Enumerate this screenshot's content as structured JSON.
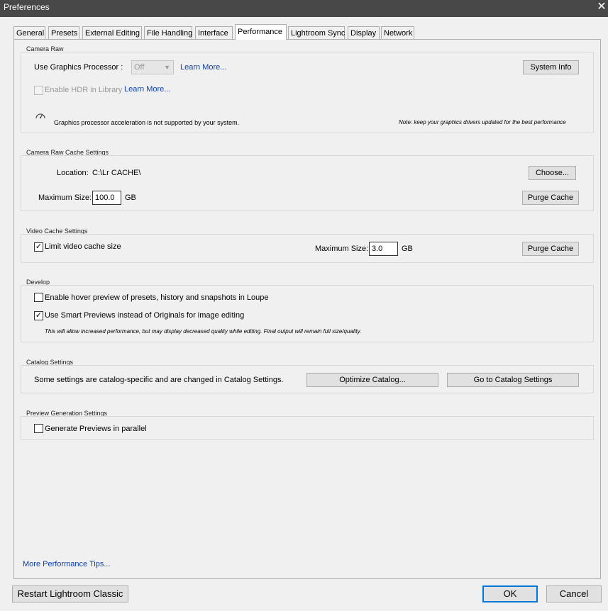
{
  "window": {
    "title": "Preferences",
    "close_glyph": "✕"
  },
  "tabs": [
    {
      "label": "General"
    },
    {
      "label": "Presets"
    },
    {
      "label": "External Editing"
    },
    {
      "label": "File Handling"
    },
    {
      "label": "Interface"
    },
    {
      "label": "Performance",
      "active": true
    },
    {
      "label": "Lightroom Sync"
    },
    {
      "label": "Display"
    },
    {
      "label": "Network"
    }
  ],
  "camera_raw": {
    "title": "Camera Raw",
    "gpu_label": "Use Graphics Processor :",
    "gpu_value": "Off",
    "learn_more": "Learn More...",
    "system_info": "System Info",
    "hdr_label": "Enable HDR in Library",
    "hdr_learn_more": "Learn More...",
    "hdr_checked": false,
    "gpu_message": "Graphics processor acceleration is not supported by your system.",
    "gpu_note": "Note: keep your graphics drivers updated for the best performance",
    "gauge_icon": "gauge-icon"
  },
  "cache": {
    "title": "Camera Raw Cache Settings",
    "location_label": "Location:",
    "location_value": "C:\\Lr CACHE\\",
    "choose": "Choose...",
    "max_size_label": "Maximum Size:",
    "max_size_value": "100.0",
    "unit": "GB",
    "purge": "Purge Cache"
  },
  "video_cache": {
    "title": "Video Cache Settings",
    "limit_label": "Limit video cache size",
    "limit_checked": true,
    "max_size_label": "Maximum Size:",
    "max_size_value": "3.0",
    "unit": "GB",
    "purge": "Purge Cache"
  },
  "develop": {
    "title": "Develop",
    "hover_label": "Enable hover preview of presets, history and snapshots in Loupe",
    "hover_checked": false,
    "smart_label": "Use Smart Previews instead of Originals for image editing",
    "smart_checked": true,
    "smart_note": "This will allow increased performance, but may display decreased quality while editing. Final output will remain full size/quality."
  },
  "catalog": {
    "title": "Catalog Settings",
    "text": "Some settings are catalog-specific and are changed in Catalog Settings.",
    "optimize": "Optimize Catalog...",
    "goto": "Go to Catalog Settings"
  },
  "preview": {
    "title": "Preview Generation Settings",
    "parallel_label": "Generate Previews in parallel",
    "parallel_checked": false
  },
  "tips_link": "More Performance Tips...",
  "footer": {
    "restart": "Restart Lightroom Classic",
    "ok": "OK",
    "cancel": "Cancel"
  },
  "check_glyph": "✓",
  "dropdown_glyph": "▼",
  "colors": {
    "titlebar": "#484848",
    "link": "#0b3fa8",
    "dialog_bg": "#f0f0f0",
    "accent": "#0078d7"
  }
}
